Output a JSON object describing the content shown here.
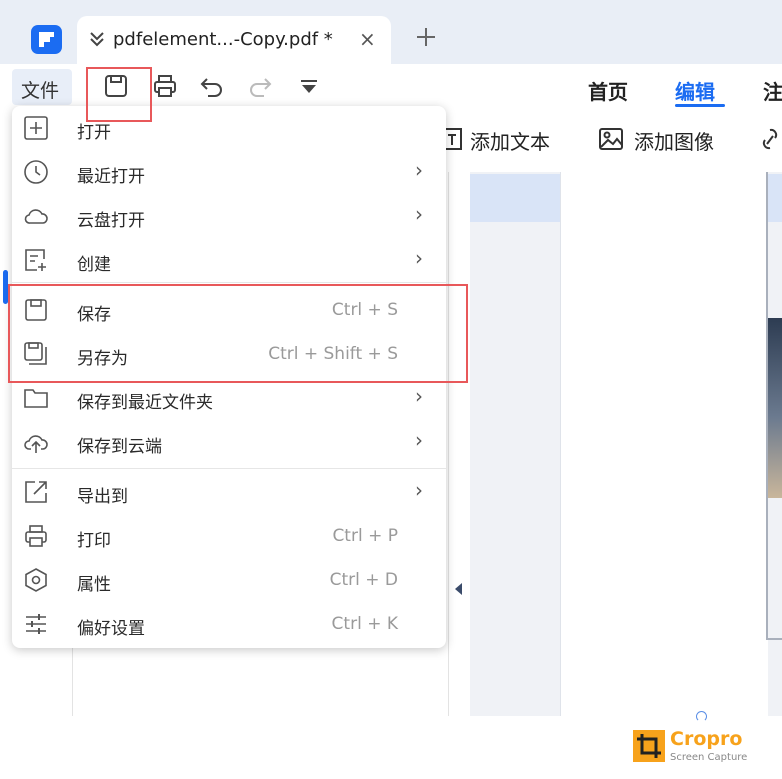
{
  "tab": {
    "title": "pdfelement...-Copy.pdf *",
    "close_glyph": "×"
  },
  "toolbar": {
    "file_menu_label": "文件",
    "quick_actions": [
      "save-icon",
      "print-icon",
      "undo-icon",
      "redo-icon",
      "customize-dropdown-icon"
    ],
    "tabs": [
      {
        "label": "首页",
        "active": false
      },
      {
        "label": "编辑",
        "active": true
      },
      {
        "label": "注",
        "active": false
      }
    ]
  },
  "ribbon": {
    "add_text": "添加文本",
    "add_image": "添加图像"
  },
  "menu": {
    "items": [
      {
        "label": "打开",
        "icon": "plus-square-icon",
        "shortcut": "",
        "submenu": false
      },
      {
        "label": "最近打开",
        "icon": "clock-icon",
        "shortcut": "",
        "submenu": true
      },
      {
        "label": "云盘打开",
        "icon": "cloud-icon",
        "shortcut": "",
        "submenu": true
      },
      {
        "label": "创建",
        "icon": "create-doc-icon",
        "shortcut": "",
        "submenu": true
      },
      {
        "label": "保存",
        "icon": "save-icon",
        "shortcut": "Ctrl + S",
        "submenu": false
      },
      {
        "label": "另存为",
        "icon": "save-as-icon",
        "shortcut": "Ctrl + Shift + S",
        "submenu": false
      },
      {
        "label": "保存到最近文件夹",
        "icon": "folder-icon",
        "shortcut": "",
        "submenu": true
      },
      {
        "label": "保存到云端",
        "icon": "cloud-upload-icon",
        "shortcut": "",
        "submenu": true
      },
      {
        "label": "导出到",
        "icon": "export-icon",
        "shortcut": "",
        "submenu": true
      },
      {
        "label": "打印",
        "icon": "print-icon",
        "shortcut": "Ctrl + P",
        "submenu": false
      },
      {
        "label": "属性",
        "icon": "properties-icon",
        "shortcut": "Ctrl + D",
        "submenu": false
      },
      {
        "label": "偏好设置",
        "icon": "sliders-icon",
        "shortcut": "Ctrl + K",
        "submenu": false
      }
    ],
    "submenu_glyph": "›"
  },
  "watermark": {
    "name": "Cropro",
    "subtitle": "Screen Capture"
  },
  "colors": {
    "accent": "#1b6cf2",
    "highlight_box": "#e8585a",
    "watermark": "#f7a21b"
  }
}
